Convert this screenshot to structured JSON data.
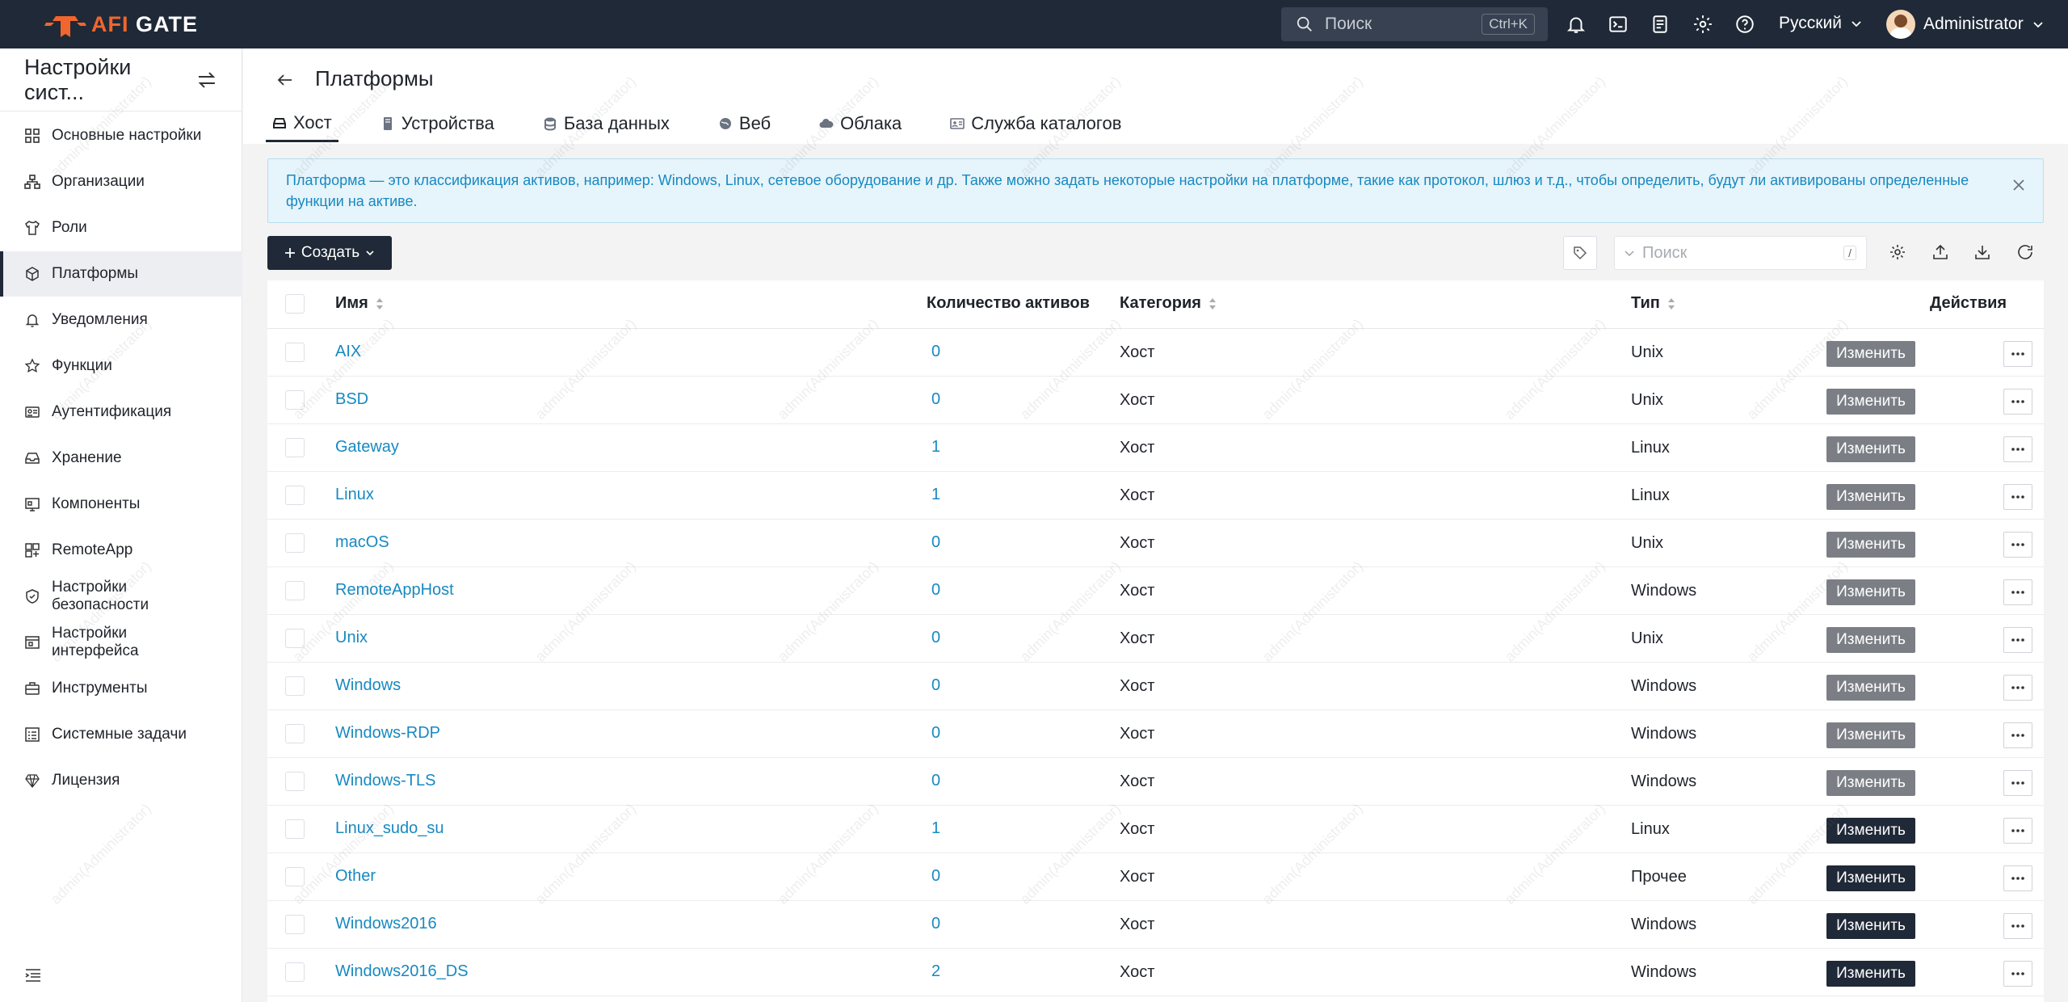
{
  "header": {
    "logo_prefix": "AFI",
    "logo_suffix": "GATE",
    "search_placeholder": "Поиск",
    "search_shortcut": "Ctrl+K",
    "language": "Русский",
    "user_name": "Administrator"
  },
  "sidebar": {
    "title": "Настройки сист...",
    "items": [
      {
        "label": "Основные настройки",
        "icon": "grid-icon"
      },
      {
        "label": "Организации",
        "icon": "org-icon"
      },
      {
        "label": "Роли",
        "icon": "shirt-icon"
      },
      {
        "label": "Платформы",
        "icon": "cube-icon"
      },
      {
        "label": "Уведомления",
        "icon": "bell-icon"
      },
      {
        "label": "Функции",
        "icon": "star-icon"
      },
      {
        "label": "Аутентификация",
        "icon": "id-card-icon"
      },
      {
        "label": "Хранение",
        "icon": "storage-icon"
      },
      {
        "label": "Компоненты",
        "icon": "components-icon"
      },
      {
        "label": "RemoteApp",
        "icon": "remoteapp-icon"
      },
      {
        "label": "Настройки безопасности",
        "icon": "shield-icon"
      },
      {
        "label": "Настройки интерфейса",
        "icon": "interface-icon"
      },
      {
        "label": "Инструменты",
        "icon": "toolbox-icon"
      },
      {
        "label": "Системные задачи",
        "icon": "tasks-icon"
      },
      {
        "label": "Лицензия",
        "icon": "diamond-icon"
      }
    ]
  },
  "page": {
    "title": "Платформы",
    "tabs": [
      {
        "label": "Хост"
      },
      {
        "label": "Устройства"
      },
      {
        "label": "База данных"
      },
      {
        "label": "Веб"
      },
      {
        "label": "Облака"
      },
      {
        "label": "Служба каталогов"
      }
    ],
    "info_text": "Платформа — это классификация активов, например: Windows, Linux, сетевое оборудование и др. Также можно задать некоторые настройки на платформе, такие как протокол, шлюз и т.д., чтобы определить, будут ли активированы определенные функции на активе.",
    "create_label": "Создать",
    "search_placeholder": "Поиск",
    "search_shortcut": "/"
  },
  "table": {
    "columns": {
      "name": "Имя",
      "count": "Количество активов",
      "category": "Категория",
      "type": "Тип",
      "actions": "Действия"
    },
    "edit_label": "Изменить",
    "more_label": "•••",
    "rows": [
      {
        "name": "AIX",
        "count": "0",
        "category": "Хост",
        "type": "Unix"
      },
      {
        "name": "BSD",
        "count": "0",
        "category": "Хост",
        "type": "Unix"
      },
      {
        "name": "Gateway",
        "count": "1",
        "category": "Хост",
        "type": "Linux"
      },
      {
        "name": "Linux",
        "count": "1",
        "category": "Хост",
        "type": "Linux"
      },
      {
        "name": "macOS",
        "count": "0",
        "category": "Хост",
        "type": "Unix"
      },
      {
        "name": "RemoteAppHost",
        "count": "0",
        "category": "Хост",
        "type": "Windows"
      },
      {
        "name": "Unix",
        "count": "0",
        "category": "Хост",
        "type": "Unix"
      },
      {
        "name": "Windows",
        "count": "0",
        "category": "Хост",
        "type": "Windows"
      },
      {
        "name": "Windows-RDP",
        "count": "0",
        "category": "Хост",
        "type": "Windows"
      },
      {
        "name": "Windows-TLS",
        "count": "0",
        "category": "Хост",
        "type": "Windows"
      },
      {
        "name": "Linux_sudo_su",
        "count": "1",
        "category": "Хост",
        "type": "Linux"
      },
      {
        "name": "Other",
        "count": "0",
        "category": "Хост",
        "type": "Прочее"
      },
      {
        "name": "Windows2016",
        "count": "0",
        "category": "Хост",
        "type": "Windows"
      },
      {
        "name": "Windows2016_DS",
        "count": "2",
        "category": "Хост",
        "type": "Windows"
      }
    ]
  },
  "watermark": "admin(Administrator)",
  "colors": {
    "topbar": "#1f2937",
    "accent": "#f0662e",
    "link": "#1789c1",
    "info_bg": "#e6f4fb",
    "edit_builtin": "#7b7f85",
    "edit_custom": "#1f2937"
  }
}
